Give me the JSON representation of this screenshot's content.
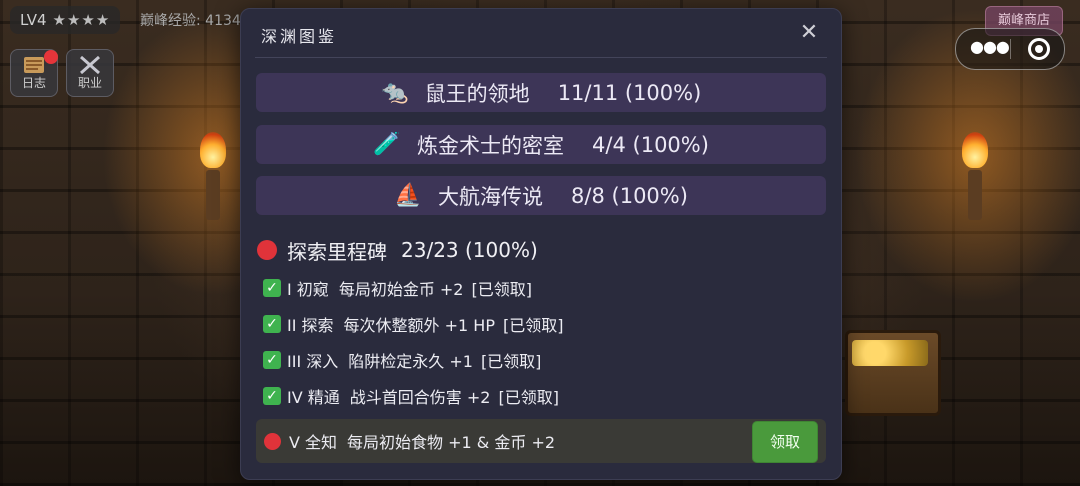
{
  "hud": {
    "level": "LV4",
    "stars": "★★★★",
    "exp_text": "巅峰经验: 4134",
    "shop_label": "巅峰商店",
    "journal_label": "日志",
    "class_label": "职业"
  },
  "icons": {
    "journal": "journal-book-icon",
    "class": "crossed-swords-icon",
    "menu": "more-dots-icon",
    "capture": "target-circle-icon"
  },
  "modal": {
    "title": "深渊图鉴",
    "close": "✕",
    "regions": [
      {
        "emoji": "🐀",
        "name": "鼠王的领地",
        "progress": "11/11 (100%)"
      },
      {
        "emoji": "🧪",
        "name": "炼金术士的密室",
        "progress": "4/4 (100%)"
      },
      {
        "emoji": "⛵",
        "name": "大航海传说",
        "progress": "8/8 (100%)"
      }
    ],
    "milestones": {
      "title": "探索里程碑",
      "progress": "23/23 (100%)",
      "items": [
        {
          "rank": "I 初窥",
          "desc": "每局初始金币 +2",
          "status": "[已领取]"
        },
        {
          "rank": "II 探索",
          "desc": "每次休整额外 +1 HP",
          "status": "[已领取]"
        },
        {
          "rank": "III 深入",
          "desc": "陷阱检定永久 +1",
          "status": "[已领取]"
        },
        {
          "rank": "IV 精通",
          "desc": "战斗首回合伤害 +2",
          "status": "[已领取]"
        }
      ],
      "active": {
        "rank": "V 全知",
        "desc": "每局初始食物 +1 & 金币 +2",
        "button": "领取"
      }
    }
  },
  "colors": {
    "modal_bg": "#2a2b3d",
    "region_bg": "#3d3557",
    "check_green": "#3fb34f",
    "alert_red": "#e0333a",
    "claim_green": "#4a9a3c"
  }
}
